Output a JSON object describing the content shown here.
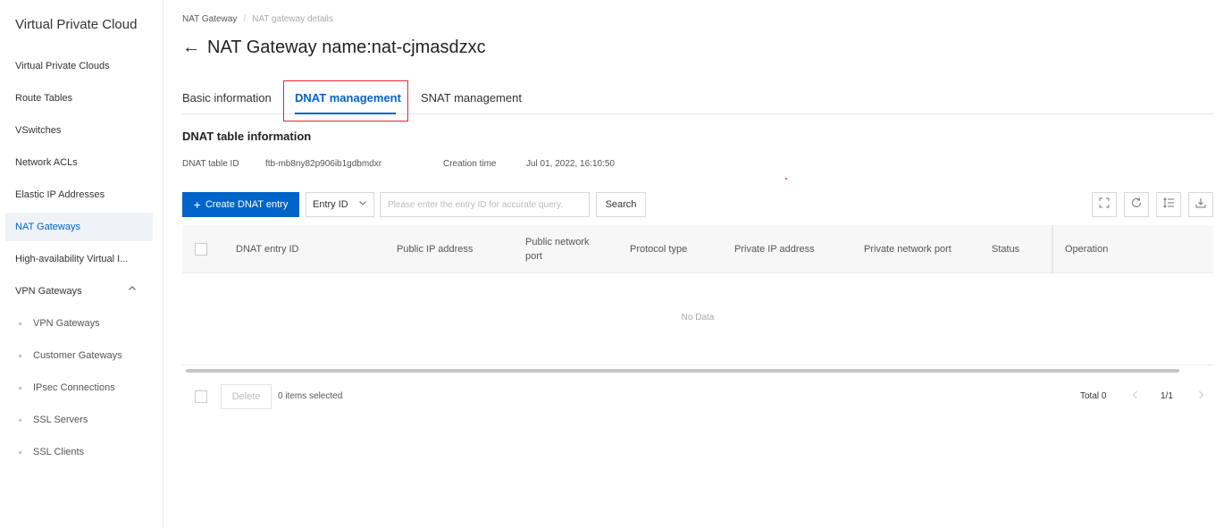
{
  "sidebar": {
    "title": "Virtual Private Cloud",
    "items": [
      {
        "label": "Virtual Private Clouds"
      },
      {
        "label": "Route Tables"
      },
      {
        "label": "VSwitches"
      },
      {
        "label": "Network ACLs"
      },
      {
        "label": "Elastic IP Addresses"
      },
      {
        "label": "NAT Gateways",
        "active": true
      },
      {
        "label": "High-availability Virtual I..."
      },
      {
        "label": "VPN Gateways",
        "expanded": true
      }
    ],
    "sub_items": [
      {
        "label": "VPN Gateways"
      },
      {
        "label": "Customer Gateways"
      },
      {
        "label": "IPsec Connections"
      },
      {
        "label": "SSL Servers"
      },
      {
        "label": "SSL Clients"
      }
    ]
  },
  "breadcrumb": {
    "items": [
      "NAT Gateway",
      "NAT gateway details"
    ],
    "separator": "/"
  },
  "page": {
    "back_icon": "←",
    "title": "NAT Gateway name:nat-cjmasdzxc"
  },
  "tabs": [
    {
      "label": "Basic information"
    },
    {
      "label": "DNAT management",
      "active": true
    },
    {
      "label": "SNAT management"
    }
  ],
  "section": {
    "title": "DNAT table information",
    "table_id_label": "DNAT table ID",
    "table_id_value": "ftb-mb8ny82p906ib1gdbmdxr",
    "creation_time_label": "Creation time",
    "creation_time_value": "Jul 01, 2022, 16:10:50"
  },
  "toolbar": {
    "create_label": "Create DNAT entry",
    "filter_select": "Entry ID",
    "search_placeholder": "Please enter the entry ID for accurate query.",
    "search_label": "Search",
    "icons": [
      "fullscreen-icon",
      "refresh-icon",
      "column-settings-icon",
      "download-icon"
    ]
  },
  "table": {
    "columns": [
      "DNAT entry ID",
      "Public IP address",
      "Public network port",
      "Protocol type",
      "Private IP address",
      "Private network port",
      "Status",
      "Operation"
    ],
    "empty_text": "No Data"
  },
  "footer": {
    "delete_label": "Delete",
    "selected_text": "0 items selected",
    "total_text": "Total 0",
    "page_text": "1/1"
  },
  "colors": {
    "accent": "#0064c8",
    "highlight": "#e8262d"
  }
}
